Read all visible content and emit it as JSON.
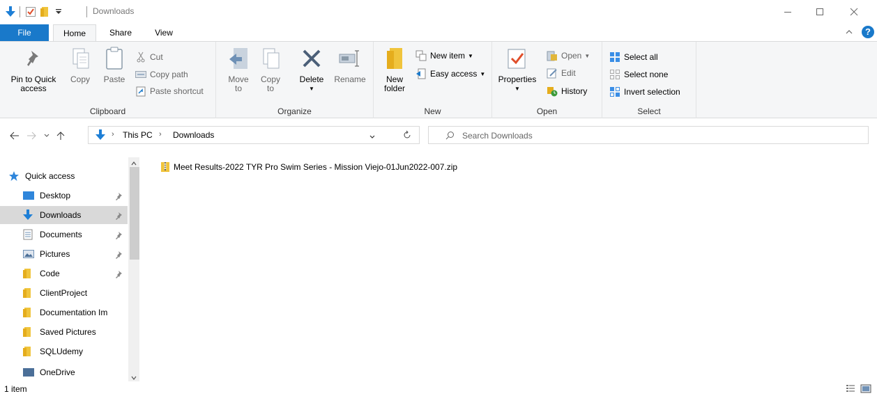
{
  "window": {
    "title": "Downloads",
    "accent": "#1979ca",
    "controls": [
      "minimize-icon",
      "maximize-icon",
      "close-icon"
    ]
  },
  "ribbon_tabs": {
    "file": "File",
    "home": "Home",
    "share": "Share",
    "view": "View"
  },
  "clipboard": {
    "group_label": "Clipboard",
    "pin_line1": "Pin to Quick",
    "pin_line2": "access",
    "copy": "Copy",
    "paste": "Paste",
    "cut": "Cut",
    "copy_path": "Copy path",
    "paste_shortcut": "Paste shortcut"
  },
  "organize": {
    "group_label": "Organize",
    "move_line1": "Move",
    "move_line2": "to",
    "copy_line1": "Copy",
    "copy_line2": "to",
    "delete": "Delete",
    "rename": "Rename"
  },
  "new": {
    "group_label": "New",
    "folder_line1": "New",
    "folder_line2": "folder",
    "new_item": "New item",
    "easy_access": "Easy access"
  },
  "open": {
    "group_label": "Open",
    "properties": "Properties",
    "open": "Open",
    "edit": "Edit",
    "history": "History"
  },
  "select": {
    "group_label": "Select",
    "select_all": "Select all",
    "select_none": "Select none",
    "invert": "Invert selection"
  },
  "address": {
    "segments": [
      "This PC",
      "Downloads"
    ],
    "search_placeholder": "Search Downloads"
  },
  "nav_pane": {
    "quick_access": "Quick access",
    "items": [
      {
        "label": "Desktop",
        "icon": "desktop-icon",
        "pinned": true
      },
      {
        "label": "Downloads",
        "icon": "download-icon",
        "pinned": true,
        "selected": true
      },
      {
        "label": "Documents",
        "icon": "document-icon",
        "pinned": true
      },
      {
        "label": "Pictures",
        "icon": "pictures-icon",
        "pinned": true
      },
      {
        "label": "Code",
        "icon": "folder-icon",
        "pinned": true
      },
      {
        "label": "ClientProject",
        "icon": "folder-icon",
        "pinned": false
      },
      {
        "label": "Documentation Im",
        "icon": "folder-icon",
        "pinned": false
      },
      {
        "label": "Saved Pictures",
        "icon": "folder-icon",
        "pinned": false
      },
      {
        "label": "SQLUdemy",
        "icon": "folder-icon",
        "pinned": false
      }
    ],
    "onedrive": "OneDrive"
  },
  "files": [
    {
      "name": "Meet Results-2022 TYR Pro Swim Series - Mission Viejo-01Jun2022-007.zip",
      "icon": "zip-folder-icon"
    }
  ],
  "status": {
    "count": "1 item"
  }
}
